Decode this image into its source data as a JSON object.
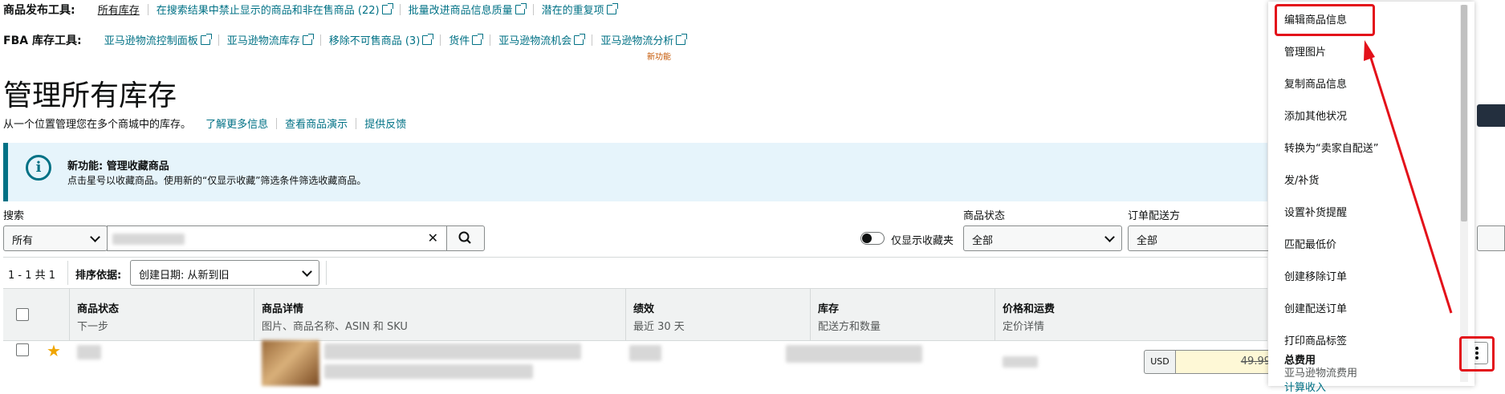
{
  "tool_rows": {
    "listing": {
      "label": "商品发布工具:",
      "links": [
        "所有库存",
        "在搜索结果中禁止显示的商品和非在售商品 (22)",
        "批量改进商品信息质量",
        "潜在的重复项"
      ]
    },
    "fba": {
      "label": "FBA 库存工具:",
      "links": [
        "亚马逊物流控制面板",
        "亚马逊物流库存",
        "移除不可售商品 (3)",
        "货件",
        "亚马逊物流机会",
        "亚马逊物流分析"
      ],
      "new_badge": "新功能"
    }
  },
  "page": {
    "title": "管理所有库存",
    "subtitle": "从一个位置管理您在多个商城中的库存。",
    "sub_links": [
      "了解更多信息",
      "查看商品演示",
      "提供反馈"
    ]
  },
  "banner": {
    "icon": "info-icon",
    "heading": "新功能: 管理收藏商品",
    "body": "点击星号以收藏商品。使用新的“仅显示收藏”筛选条件筛选收藏商品。"
  },
  "filters": {
    "search_label": "搜索",
    "scope_value": "所有",
    "favorites_toggle": "仅显示收藏夹",
    "status_label": "商品状态",
    "status_value": "全部",
    "fulfillment_label": "订单配送方",
    "fulfillment_value": "全部"
  },
  "results": {
    "count": "1 - 1 共 1",
    "sort_label": "排序依据:",
    "sort_value": "创建日期: 从新到旧"
  },
  "table": {
    "columns": [
      {
        "title": "商品状态",
        "sub": "下一步"
      },
      {
        "title": "商品详情",
        "sub": "图片、商品名称、ASIN 和 SKU"
      },
      {
        "title": "绩效",
        "sub": "最近 30 天"
      },
      {
        "title": "库存",
        "sub": "配送方和数量"
      },
      {
        "title": "价格和运费",
        "sub": "定价详情"
      }
    ],
    "row": {
      "currency": "USD",
      "price": "49.99",
      "total_fee_label": "总费用",
      "fee_type": "亚马逊物流费用",
      "calc_link": "计算收入"
    }
  },
  "menu": {
    "items": [
      "编辑商品信息",
      "管理图片",
      "复制商品信息",
      "添加其他状况",
      "转换为“卖家自配送”",
      "发/补货",
      "设置补货提醒",
      "匹配最低价",
      "创建移除订单",
      "创建配送订单",
      "打印商品标签"
    ]
  },
  "colors": {
    "link": "#007185",
    "highlight": "#e3111a",
    "banner_bg": "#e6f4fb",
    "new_badge": "#c45500"
  }
}
